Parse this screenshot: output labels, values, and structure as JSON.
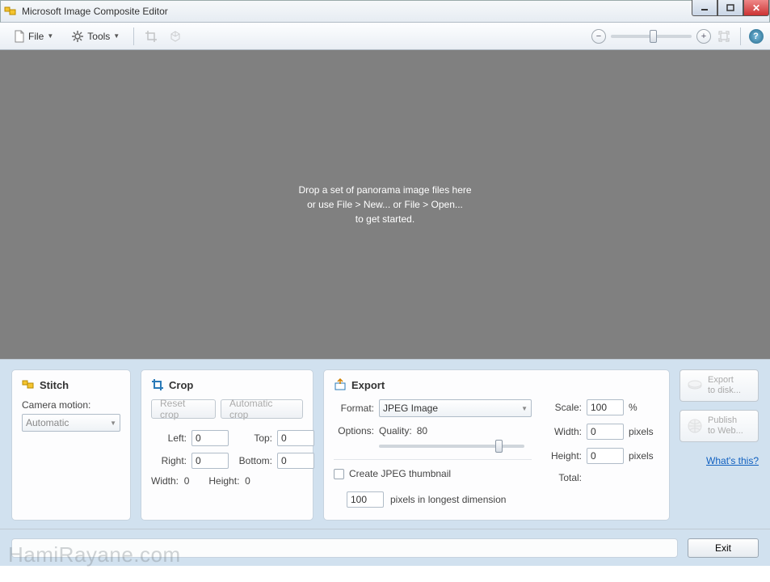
{
  "window": {
    "title": "Microsoft Image Composite Editor"
  },
  "toolbar": {
    "file_label": "File",
    "tools_label": "Tools"
  },
  "canvas": {
    "msg_line1": "Drop a set of panorama image files here",
    "msg_line2": "or use File > New... or File > Open...",
    "msg_line3": "to get started."
  },
  "stitch": {
    "title": "Stitch",
    "camera_motion_label": "Camera motion:",
    "camera_motion_value": "Automatic"
  },
  "crop": {
    "title": "Crop",
    "reset_label": "Reset crop",
    "auto_label": "Automatic crop",
    "left_label": "Left:",
    "left_value": "0",
    "top_label": "Top:",
    "top_value": "0",
    "right_label": "Right:",
    "right_value": "0",
    "bottom_label": "Bottom:",
    "bottom_value": "0",
    "width_label": "Width:",
    "width_value": "0",
    "height_label": "Height:",
    "height_value": "0"
  },
  "export": {
    "title": "Export",
    "format_label": "Format:",
    "format_value": "JPEG Image",
    "options_label": "Options:",
    "quality_label": "Quality:",
    "quality_value": "80",
    "thumb_check_label": "Create JPEG thumbnail",
    "thumb_px_value": "100",
    "thumb_px_label": "pixels in longest dimension",
    "scale_label": "Scale:",
    "scale_value": "100",
    "scale_unit": "%",
    "width_label": "Width:",
    "width_value": "0",
    "width_unit": "pixels",
    "height_label": "Height:",
    "height_value": "0",
    "height_unit": "pixels",
    "total_label": "Total:"
  },
  "side": {
    "export_disk_l1": "Export",
    "export_disk_l2": "to disk...",
    "publish_l1": "Publish",
    "publish_l2": "to Web...",
    "whats_this": "What's this?"
  },
  "status": {
    "exit_label": "Exit"
  },
  "watermark": "HamiRayane.com"
}
